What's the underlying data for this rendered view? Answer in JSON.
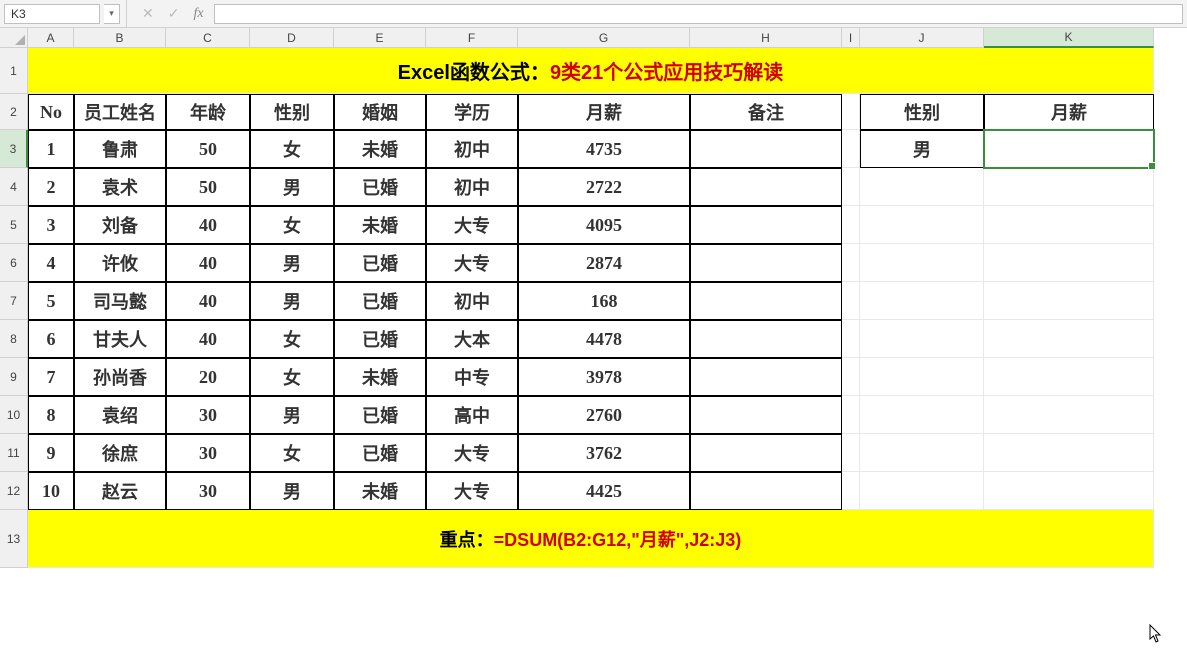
{
  "namebox": "K3",
  "columns": [
    "A",
    "B",
    "C",
    "D",
    "E",
    "F",
    "G",
    "H",
    "I",
    "J",
    "K"
  ],
  "row_labels": [
    "1",
    "2",
    "3",
    "4",
    "5",
    "6",
    "7",
    "8",
    "9",
    "10",
    "11",
    "12",
    "13"
  ],
  "title": {
    "part1": "Excel函数公式：",
    "part2": "9类21个公式应用技巧解读"
  },
  "headers": {
    "no": "No",
    "name": "员工姓名",
    "age": "年龄",
    "sex": "性别",
    "marry": "婚姻",
    "edu": "学历",
    "salary": "月薪",
    "note": "备注"
  },
  "criteria_headers": {
    "sex": "性别",
    "salary": "月薪"
  },
  "criteria": {
    "sex": "男",
    "salary": ""
  },
  "rows": [
    {
      "no": "1",
      "name": "鲁肃",
      "age": "50",
      "sex": "女",
      "marry": "未婚",
      "edu": "初中",
      "salary": "4735",
      "note": ""
    },
    {
      "no": "2",
      "name": "袁术",
      "age": "50",
      "sex": "男",
      "marry": "已婚",
      "edu": "初中",
      "salary": "2722",
      "note": ""
    },
    {
      "no": "3",
      "name": "刘备",
      "age": "40",
      "sex": "女",
      "marry": "未婚",
      "edu": "大专",
      "salary": "4095",
      "note": ""
    },
    {
      "no": "4",
      "name": "许攸",
      "age": "40",
      "sex": "男",
      "marry": "已婚",
      "edu": "大专",
      "salary": "2874",
      "note": ""
    },
    {
      "no": "5",
      "name": "司马懿",
      "age": "40",
      "sex": "男",
      "marry": "已婚",
      "edu": "初中",
      "salary": "168",
      "note": ""
    },
    {
      "no": "6",
      "name": "甘夫人",
      "age": "40",
      "sex": "女",
      "marry": "已婚",
      "edu": "大本",
      "salary": "4478",
      "note": ""
    },
    {
      "no": "7",
      "name": "孙尚香",
      "age": "20",
      "sex": "女",
      "marry": "未婚",
      "edu": "中专",
      "salary": "3978",
      "note": ""
    },
    {
      "no": "8",
      "name": "袁绍",
      "age": "30",
      "sex": "男",
      "marry": "已婚",
      "edu": "高中",
      "salary": "2760",
      "note": ""
    },
    {
      "no": "9",
      "name": "徐庶",
      "age": "30",
      "sex": "女",
      "marry": "已婚",
      "edu": "大专",
      "salary": "3762",
      "note": ""
    },
    {
      "no": "10",
      "name": "赵云",
      "age": "30",
      "sex": "男",
      "marry": "未婚",
      "edu": "大专",
      "salary": "4425",
      "note": ""
    }
  ],
  "band": {
    "part1": "重点：",
    "part2": "=DSUM(B2:G12,\"月薪\",J2:J3)"
  }
}
